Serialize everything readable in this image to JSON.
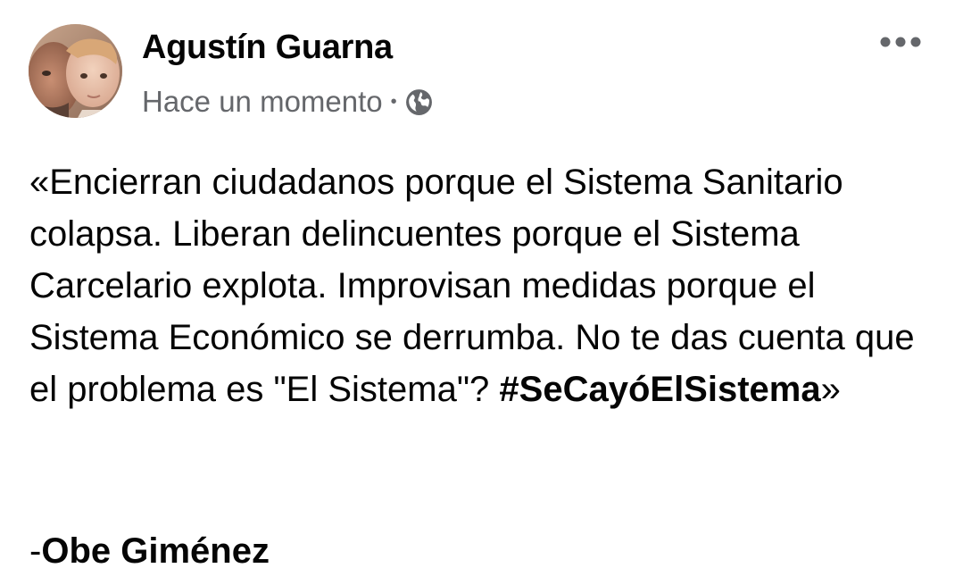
{
  "post": {
    "author": "Agustín Guarna",
    "timestamp": "Hace un momento",
    "separator": "•",
    "audience_icon": "globe-icon",
    "menu_icon": "more-options-icon",
    "body_text": "«Encierran ciudadanos porque el Sistema Sanitario colapsa. Liberan delincuentes porque el Sistema Carcelario explota. Improvisan medidas porque el Sistema Económico se derrumba. No te das cuenta que el problema es \"El Sistema\"? ",
    "hashtag": "#SeCayóElSistema",
    "closing_quote": "»",
    "signature_dash": "-",
    "signature_name": "Obe Giménez"
  },
  "colors": {
    "text_primary": "#050505",
    "text_secondary": "#65676b",
    "background": "#ffffff"
  }
}
